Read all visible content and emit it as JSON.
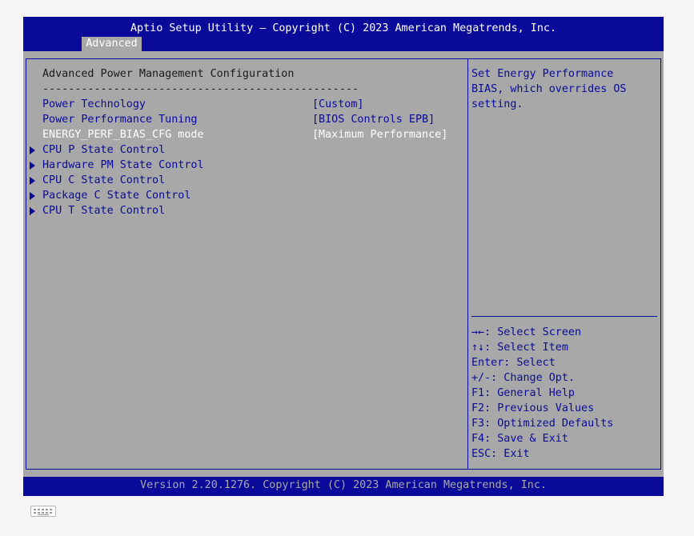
{
  "header": {
    "title": "Aptio Setup Utility – Copyright (C) 2023 American Megatrends, Inc.",
    "active_tab": "Advanced"
  },
  "main": {
    "section_title": "Advanced Power Management Configuration",
    "separator": "-------------------------------------------------",
    "settings": [
      {
        "label": "Power Technology",
        "value": "[Custom]"
      },
      {
        "label": "Power Performance Tuning",
        "value": "[BIOS Controls EPB]"
      },
      {
        "label": "ENERGY_PERF_BIAS_CFG mode",
        "value": "[Maximum Performance]"
      }
    ],
    "submenus": [
      {
        "label": "CPU P State Control"
      },
      {
        "label": "Hardware PM State Control"
      },
      {
        "label": "CPU C State Control"
      },
      {
        "label": "Package C State Control"
      },
      {
        "label": "CPU T State Control"
      }
    ]
  },
  "help": {
    "description": [
      "Set Energy Performance",
      "BIAS, which overrides OS",
      "setting."
    ],
    "keys": [
      "→←: Select Screen",
      "↑↓: Select Item",
      "Enter: Select",
      "+/-: Change Opt.",
      "F1: General Help",
      "F2: Previous Values",
      "F3: Optimized Defaults",
      "F4: Save & Exit",
      "ESC: Exit"
    ]
  },
  "footer": {
    "text": "Version 2.20.1276. Copyright (C) 2023 American Megatrends, Inc."
  },
  "icons": {
    "submenu_arrow": "triangle-right-icon",
    "keyboard": "keyboard-icon"
  },
  "colors": {
    "background": "#a8a8a8",
    "bar": "#0a0a9a",
    "selected_text": "#ffffff",
    "item_text": "#0a0a9a"
  }
}
